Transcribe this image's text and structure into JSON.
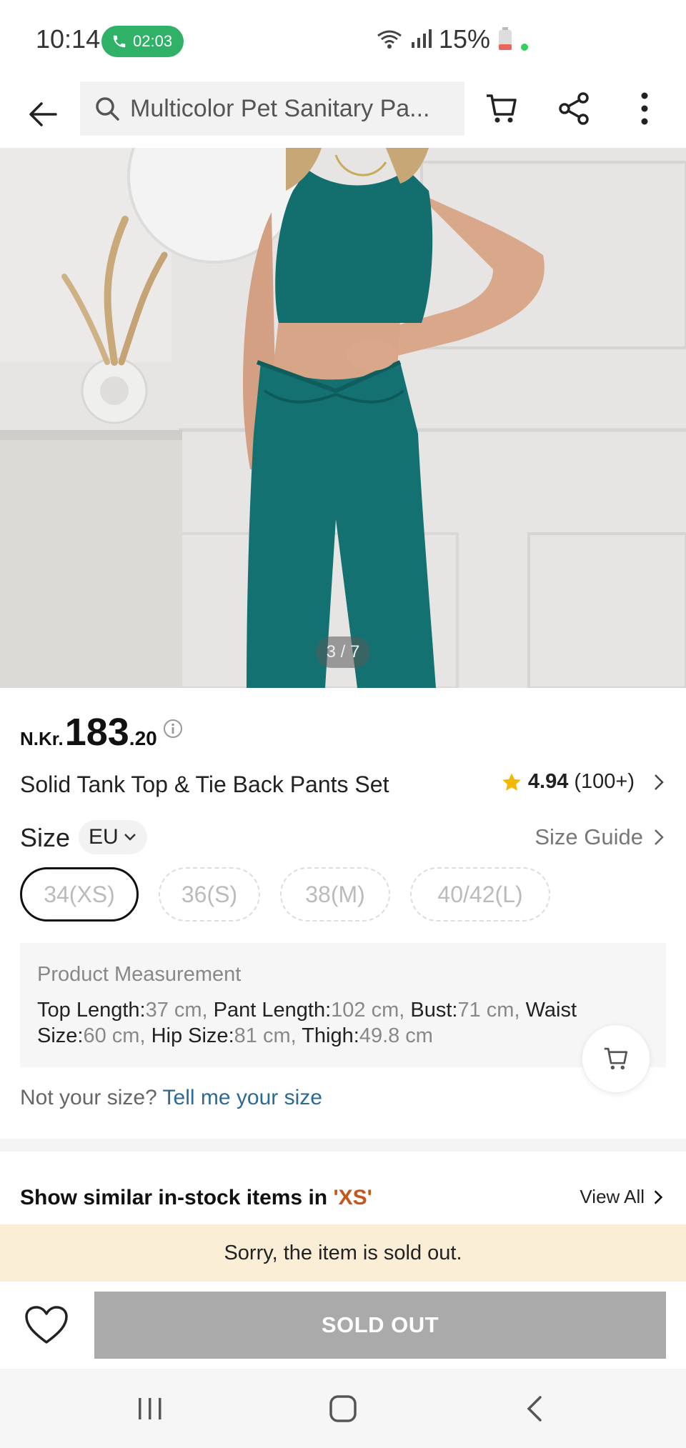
{
  "status_bar": {
    "time": "10:14",
    "call_timer": "02:03",
    "battery": "15%",
    "call_color": "#2fb168"
  },
  "top_nav": {
    "search_text": "Multicolor Pet Sanitary Pa...",
    "icons": [
      "back-arrow-icon",
      "search-icon",
      "cart-icon",
      "share-icon",
      "more-icon"
    ]
  },
  "gallery": {
    "pager": "3 / 7"
  },
  "product": {
    "currency": "N.Kr.",
    "price_int": "183",
    "price_dec": ".20",
    "title": "Solid Tank Top & Tie Back Pants Set",
    "rating_score": "4.94",
    "rating_count": "(100+)",
    "star_color": "#f5b800"
  },
  "size": {
    "label": "Size",
    "region": "EU",
    "guide_label": "Size Guide",
    "options": [
      {
        "label": "34(XS)",
        "selected": true
      },
      {
        "label": "36(S)",
        "selected": false
      },
      {
        "label": "38(M)",
        "selected": false
      },
      {
        "label": "40/42(L)",
        "selected": false
      }
    ]
  },
  "measurement": {
    "title": "Product Measurement",
    "items": [
      {
        "name": "Top Length:",
        "value": "37 cm,"
      },
      {
        "name": "Pant Length:",
        "value": "102 cm,"
      },
      {
        "name": "Bust:",
        "value": "71 cm,"
      },
      {
        "name": "Waist Size:",
        "value": "60 cm,"
      },
      {
        "name": "Hip Size:",
        "value": "81 cm,"
      },
      {
        "name": "Thigh:",
        "value": "49.8 cm"
      }
    ]
  },
  "fit": {
    "question": "Not your size?",
    "link": "Tell me your size",
    "link_color": "#2c6a95"
  },
  "similar": {
    "prefix": "Show similar in-stock items in ",
    "size": "'XS'",
    "view_all": "View All"
  },
  "sold_banner": "Sorry, the item is sold out.",
  "bottom": {
    "button": "SOLD OUT"
  }
}
